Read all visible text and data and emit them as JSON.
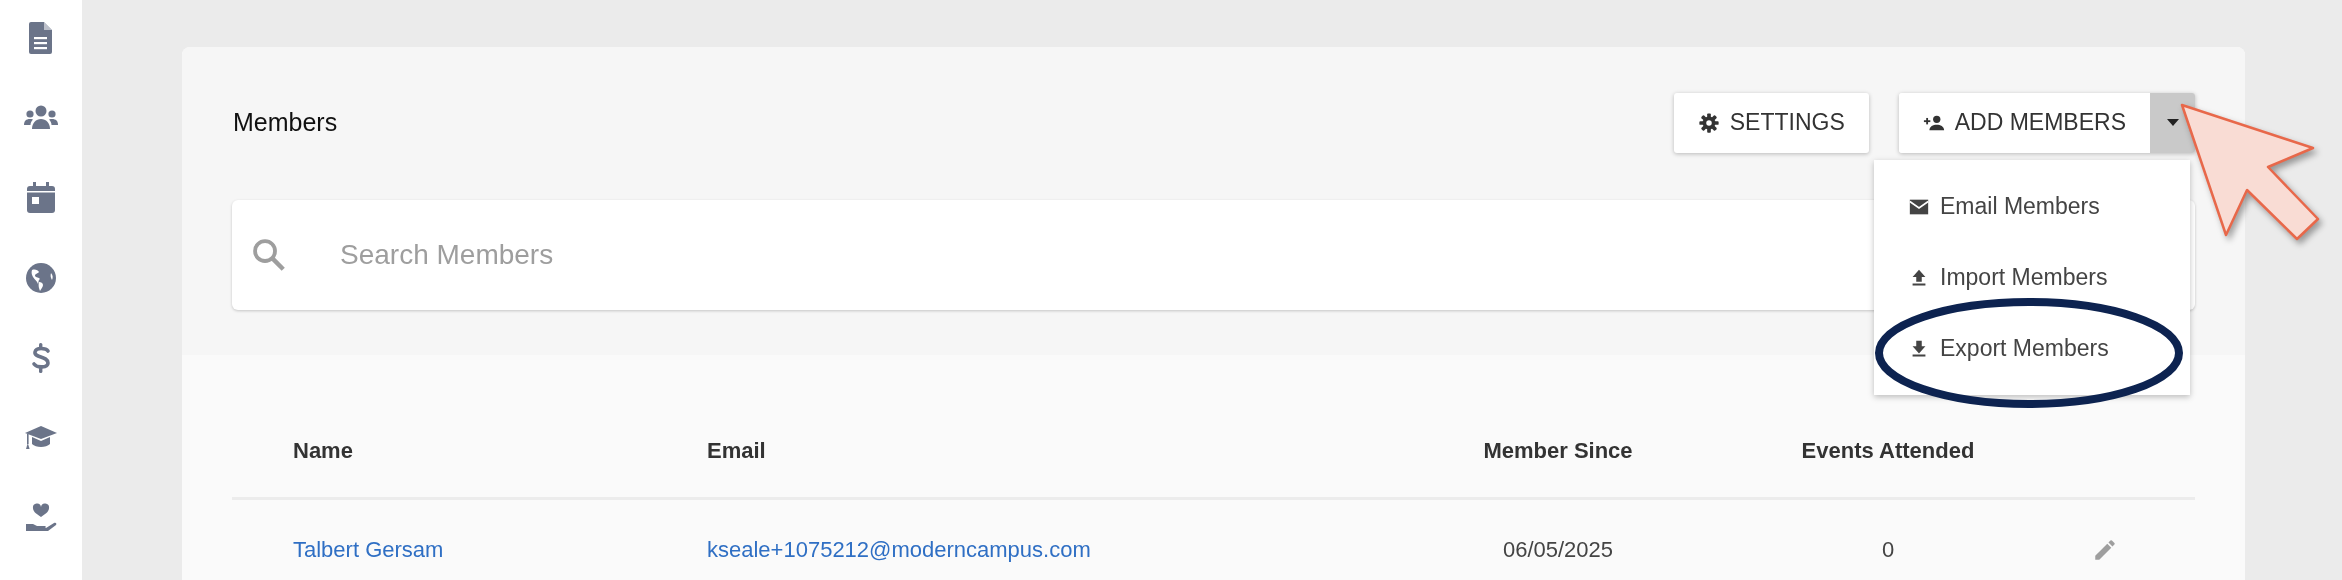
{
  "sidebar": {
    "items": [
      {
        "kind": "document"
      },
      {
        "kind": "people"
      },
      {
        "kind": "calendar"
      },
      {
        "kind": "globe"
      },
      {
        "kind": "dollar"
      },
      {
        "kind": "graduation"
      },
      {
        "kind": "donation"
      }
    ]
  },
  "panel": {
    "title": "Members",
    "buttons": [
      {
        "label": "SETTINGS",
        "kind": "settings"
      },
      {
        "label": "ADD MEMBERS",
        "kind": "add"
      }
    ],
    "dropdown": {
      "expanded": true,
      "items": [
        {
          "label": "Email Members",
          "kind": "email",
          "highlighted": false
        },
        {
          "label": "Import Members",
          "kind": "import",
          "highlighted": false
        },
        {
          "label": "Export Members",
          "kind": "export",
          "highlighted": true
        }
      ]
    },
    "search": {
      "placeholder": "Search Members"
    },
    "table": {
      "columns": [
        "Name",
        "Email",
        "Member Since",
        "Events Attended"
      ],
      "rows": [
        {
          "name": "Talbert Gersam",
          "email": "kseale+1075212@moderncampus.com",
          "member_since": "06/05/2025",
          "events_attended": "0"
        }
      ]
    }
  }
}
